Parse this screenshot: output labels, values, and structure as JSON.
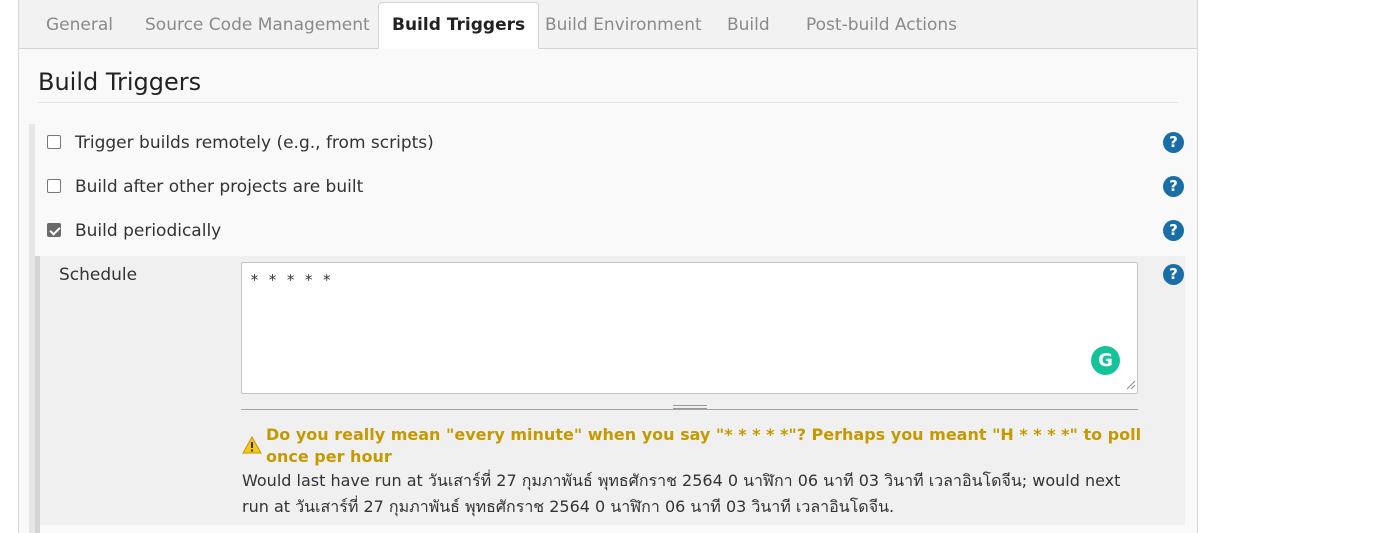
{
  "tabs": [
    {
      "label": "General"
    },
    {
      "label": "Source Code Management"
    },
    {
      "label": "Build Triggers"
    },
    {
      "label": "Build Environment"
    },
    {
      "label": "Build"
    },
    {
      "label": "Post-build Actions"
    }
  ],
  "active_tab": "Build Triggers",
  "section": {
    "title": "Build Triggers"
  },
  "triggers": [
    {
      "label": "Trigger builds remotely (e.g., from scripts)",
      "checked": false
    },
    {
      "label": "Build after other projects are built",
      "checked": false
    },
    {
      "label": "Build periodically",
      "checked": true
    }
  ],
  "schedule": {
    "label": "Schedule",
    "value": "* * * * *",
    "warning": "Do you really mean \"every minute\" when you say \"* * * * *\"? Perhaps you meant \"H * * * *\" to poll once per hour",
    "info": "Would last have run at วันเสาร์ที่ 27 กุมภาพันธ์ พุทธศักราช 2564 0 นาฬิกา 06 นาที 03 วินาที เวลาอินโดจีน; would next run at วันเสาร์ที่ 27 กุมภาพันธ์ พุทธศักราช 2564 0 นาฬิกา 06 นาที 03 วินาที เวลาอินโดจีน."
  },
  "icons": {
    "help": "help-icon",
    "warning": "warning-icon",
    "grammarly": "grammarly-icon",
    "help_glyph": "?",
    "grammarly_glyph": "G"
  },
  "colors": {
    "help_icon": "#1a6ea8",
    "warning_text": "#c49a00",
    "grammarly": "#15c39a"
  }
}
